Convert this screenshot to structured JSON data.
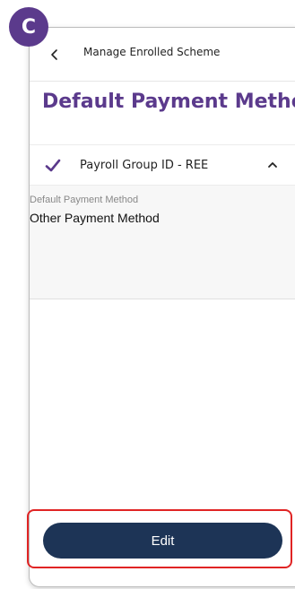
{
  "badge": {
    "letter": "C"
  },
  "header": {
    "title": "Manage Enrolled Scheme"
  },
  "page": {
    "title": "Default Payment Method"
  },
  "scheme_row": {
    "label": "Payroll Group ID - REE",
    "expanded": true
  },
  "details": {
    "field_label": "Default Payment Method",
    "field_value": "Other Payment Method"
  },
  "actions": {
    "edit_label": "Edit"
  },
  "colors": {
    "accent_purple": "#5b3a8c",
    "button_navy": "#1d3456",
    "highlight_red": "#e02424"
  },
  "icons": {
    "back": "chevron-left-icon",
    "check": "check-icon",
    "collapse": "chevron-up-icon"
  }
}
